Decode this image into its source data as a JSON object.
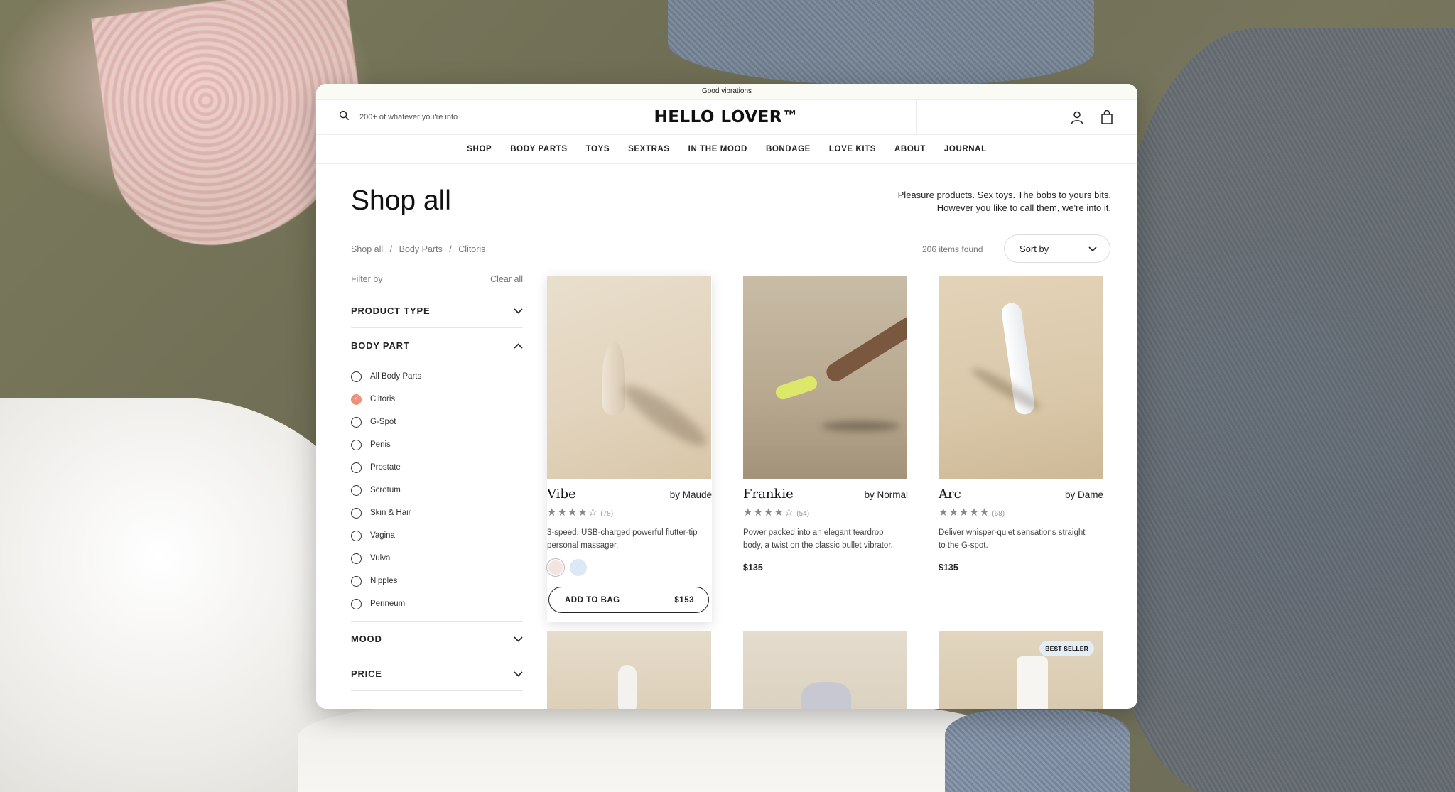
{
  "announcement": "Good vibrations",
  "search": {
    "placeholder": "200+ of whatever you're into"
  },
  "logo": "HELLO LOVER™",
  "nav": [
    "SHOP",
    "BODY PARTS",
    "TOYS",
    "SEXTRAS",
    "IN THE MOOD",
    "BONDAGE",
    "LOVE KITS",
    "ABOUT",
    "JOURNAL"
  ],
  "page": {
    "title": "Shop all",
    "intro_line1": "Pleasure products. Sex toys. The bobs to yours bits.",
    "intro_line2": "However you like to call them, we're into it."
  },
  "breadcrumb": [
    "Shop all",
    "/",
    "Body Parts",
    "/",
    "Clitoris"
  ],
  "results": {
    "count": "206 items found",
    "sort_label": "Sort by"
  },
  "filters": {
    "label": "Filter by",
    "clear": "Clear all",
    "product_type": "PRODUCT TYPE",
    "body_part": "BODY PART",
    "body_part_options": [
      {
        "label": "All Body Parts",
        "selected": false
      },
      {
        "label": "Clitoris",
        "selected": true
      },
      {
        "label": "G-Spot",
        "selected": false
      },
      {
        "label": "Penis",
        "selected": false
      },
      {
        "label": "Prostate",
        "selected": false
      },
      {
        "label": "Scrotum",
        "selected": false
      },
      {
        "label": "Skin & Hair",
        "selected": false
      },
      {
        "label": "Vagina",
        "selected": false
      },
      {
        "label": "Vulva",
        "selected": false
      },
      {
        "label": "Nipples",
        "selected": false
      },
      {
        "label": "Perineum",
        "selected": false
      }
    ],
    "mood": "MOOD",
    "price": "PRICE"
  },
  "products": [
    {
      "name": "Vibe",
      "brand": "by Maude",
      "stars": "★★★★☆",
      "reviews": "(78)",
      "desc_line1": "3-speed, USB-charged powerful flutter-tip",
      "desc_line2": "personal massager.",
      "swatches": [
        "#f3e4df",
        "#dde8f6"
      ],
      "add_label": "ADD TO BAG",
      "price": "$153"
    },
    {
      "name": "Frankie",
      "brand": "by Normal",
      "stars": "★★★★☆",
      "reviews": "(54)",
      "desc_line1": "Power packed into an elegant teardrop",
      "desc_line2": "body, a twist on the classic bullet vibrator.",
      "price": "$135"
    },
    {
      "name": "Arc",
      "brand": "by Dame",
      "stars": "★★★★★",
      "reviews": "(68)",
      "desc_line1": "Deliver whisper-quiet sensations straight",
      "desc_line2": "to the G-spot.",
      "price": "$135"
    }
  ],
  "badge": "BEST SELLER",
  "colors": {
    "accent": "#e8917c",
    "text": "#1a1a1a",
    "muted": "#777777"
  }
}
